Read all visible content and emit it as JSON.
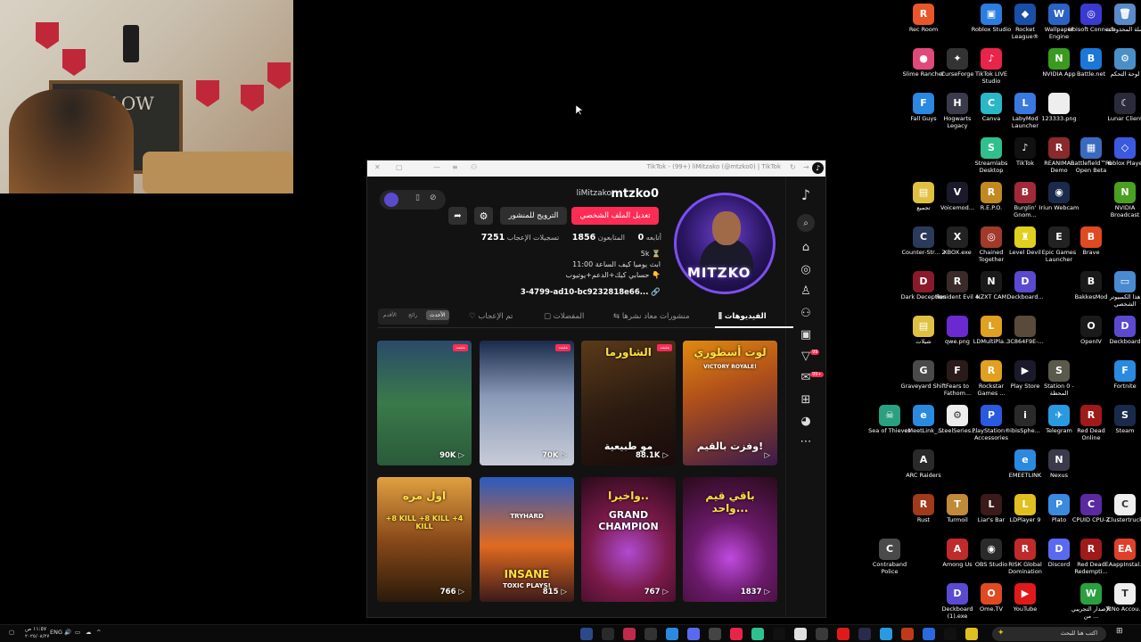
{
  "window": {
    "title": "TikTok - (99+) liMitzako (@mtzko0) | TikTok",
    "logo_icon": "tiktok-logo-icon"
  },
  "profile": {
    "username": "mtzko0",
    "nickname": "liMitzako",
    "edit_label": "تعديل الملف الشخصي",
    "promote_label": "الترويج للمنشور",
    "avatar_text": "MITZKO",
    "stats": {
      "following_label": "أتابعه",
      "following_value": "0",
      "followers_label": "المتابعون",
      "followers_value": "1856",
      "likes_label": "تسجيلات الإعجاب",
      "likes_value": "7251"
    },
    "bio_lines": [
      "5k ⏳",
      "ابث يوميا كيف الساعة 11:00",
      "حسابي كيك+الدعم+يوتيوب 👇"
    ],
    "link": "3-4799-ad10-bc9232818e66..."
  },
  "tabs": {
    "videos": "الفيديوهات",
    "reposts": "منشورات معاد نشرها",
    "favorites": "المفضلات",
    "liked": "تم الإعجاب",
    "sort_latest": "الأحدث",
    "sort_popular": "رائج",
    "sort_oldest": "الأقدم"
  },
  "videos": [
    {
      "caption": "لوت أسطوري",
      "caption2": "وفزت بالقيم!",
      "views": "",
      "pinned": false
    },
    {
      "caption": "الشاورما",
      "caption2": "مو طبيعية",
      "views": "88.1K",
      "pinned": true,
      "pin_label": "مثبت"
    },
    {
      "caption": "",
      "caption2": "",
      "views": "70K",
      "pinned": true,
      "pin_label": "مثبت"
    },
    {
      "caption": "",
      "caption2": "",
      "views": "90K",
      "pinned": true,
      "pin_label": "مثبت"
    },
    {
      "caption": "باقي قيم واحد...",
      "caption2": "",
      "views": "1837",
      "pinned": false
    },
    {
      "caption": "واخيرا..",
      "caption2": "GRAND CHAMPION",
      "views": "767",
      "pinned": false
    },
    {
      "caption": "INSANE",
      "caption2": "TOXIC PLAYS!",
      "views": "815",
      "pinned": false
    },
    {
      "caption": "اول مره",
      "caption2": "+8 KILL +8 KILL +4 KILL",
      "views": "766",
      "pinned": false
    }
  ],
  "thumb_texts": {
    "victory": "VICTORY ROYALE!",
    "tryhard": "TRYHARD"
  },
  "webcam": {
    "board_text": "FOLLOW"
  },
  "rail_badges": {
    "activity": "99",
    "inbox": "99+"
  },
  "desktop_icons": [
    {
      "label": "Rec Room",
      "color": "#e8562a",
      "glyph": "R"
    },
    {
      "label": "Roblox Studio",
      "color": "#2b7de0",
      "glyph": "▣"
    },
    {
      "label": "Rocket League®",
      "color": "#1a4fa8",
      "glyph": "◆"
    },
    {
      "label": "Wallpaper Engine",
      "color": "#2a63c4",
      "glyph": "W"
    },
    {
      "label": "Ubisoft Connect",
      "color": "#3a3ad0",
      "glyph": "◎"
    },
    {
      "label": "سلة المحذوفات",
      "color": "#5a8ac8",
      "glyph": "🗑"
    },
    {
      "label": "Slime Rancher",
      "color": "#e04a7a",
      "glyph": "●"
    },
    {
      "label": "CurseForge",
      "color": "#333333",
      "glyph": "✦"
    },
    {
      "label": "TikTok LIVE Studio",
      "color": "#e8244a",
      "glyph": "♪"
    },
    {
      "label": "NVIDIA App",
      "color": "#3a9a20",
      "glyph": "N"
    },
    {
      "label": "Battle.net",
      "color": "#1a78d8",
      "glyph": "B"
    },
    {
      "label": "لوحة التحكم",
      "color": "#4a90c8",
      "glyph": "⚙"
    },
    {
      "label": "Fall Guys",
      "color": "#2a88e0",
      "glyph": "F"
    },
    {
      "label": "Hogwarts Legacy",
      "color": "#3a3a4a",
      "glyph": "H"
    },
    {
      "label": "Canva",
      "color": "#2ab8c8",
      "glyph": "C"
    },
    {
      "label": "LabyMod Launcher",
      "color": "#3a7ae0",
      "glyph": "L"
    },
    {
      "label": "123333.png",
      "color": "#eeeeee",
      "glyph": " "
    },
    {
      "label": "Lunar Client",
      "color": "#2a2a3a",
      "glyph": "☾"
    },
    {
      "label": "Streamlabs Desktop",
      "color": "#30c090",
      "glyph": "S"
    },
    {
      "label": "TikTok",
      "color": "#111111",
      "glyph": "♪"
    },
    {
      "label": "REANIMAL Demo",
      "color": "#8a2a2a",
      "glyph": "R"
    },
    {
      "label": "Battlefield™ 6 Open Beta",
      "color": "#3a6ac0",
      "glyph": "▦"
    },
    {
      "label": "Roblox Player",
      "color": "#3a5ae0",
      "glyph": "◇"
    },
    {
      "label": "تجميع",
      "color": "#e0c040",
      "glyph": "▤"
    },
    {
      "label": "Voicemod...",
      "color": "#1a1a2a",
      "glyph": "V"
    },
    {
      "label": "R.E.P.O.",
      "color": "#c08a20",
      "glyph": "R"
    },
    {
      "label": "Burglin' Gnom...",
      "color": "#a02a3a",
      "glyph": "B"
    },
    {
      "label": "Iriun Webcam",
      "color": "#1a2a4a",
      "glyph": "◉"
    },
    {
      "label": "NVIDIA Broadcast",
      "color": "#4aa020",
      "glyph": "N"
    },
    {
      "label": "Counter-Str... 2",
      "color": "#2a3a5a",
      "glyph": "C"
    },
    {
      "label": "XBOX.exe",
      "color": "#222222",
      "glyph": "X"
    },
    {
      "label": "Chained Together",
      "color": "#a03a2a",
      "glyph": "◎"
    },
    {
      "label": "Level Devil",
      "color": "#e0d020",
      "glyph": "♜"
    },
    {
      "label": "Epic Games Launcher",
      "color": "#222222",
      "glyph": "E"
    },
    {
      "label": "Brave",
      "color": "#e04a20",
      "glyph": "B"
    },
    {
      "label": "Dark Deception",
      "color": "#8a1a2a",
      "glyph": "D"
    },
    {
      "label": "Resident Evil 4",
      "color": "#3a2a2a",
      "glyph": "R"
    },
    {
      "label": "NZXT CAM",
      "color": "#1a1a1a",
      "glyph": "N"
    },
    {
      "label": "Deckboard...",
      "color": "#5a4ad0",
      "glyph": "D"
    },
    {
      "label": "BakkesMod",
      "color": "#1a1a1a",
      "glyph": "B"
    },
    {
      "label": "هذا الكمبيوتر الشخصي",
      "color": "#4a8ad0",
      "glyph": "▭"
    },
    {
      "label": "شيلات",
      "color": "#e0c040",
      "glyph": "▤"
    },
    {
      "label": "qwe.png",
      "color": "#6a2ad0",
      "glyph": " "
    },
    {
      "label": "LDMultiPla...",
      "color": "#e0a020",
      "glyph": "L"
    },
    {
      "label": "3C864F9E-...",
      "color": "#5a4a3a",
      "glyph": " "
    },
    {
      "label": "OpenIV",
      "color": "#1a1a1a",
      "glyph": "O"
    },
    {
      "label": "Deckboard",
      "color": "#5a4ad0",
      "glyph": "D"
    },
    {
      "label": "Graveyard Shift",
      "color": "#4a4a4a",
      "glyph": "G"
    },
    {
      "label": "Fears to Fathom...",
      "color": "#2a1a1a",
      "glyph": "F"
    },
    {
      "label": "Rockstar Games ...",
      "color": "#e0a020",
      "glyph": "R"
    },
    {
      "label": "Play Store",
      "color": "#1a1a2a",
      "glyph": "▶"
    },
    {
      "label": "Station 0 - المحطة",
      "color": "#5a5a4a",
      "glyph": "S"
    },
    {
      "label": "Fortnite",
      "color": "#2a8ae0",
      "glyph": "F"
    },
    {
      "label": "Sea of Thieves",
      "color": "#2aa080",
      "glyph": "☠"
    },
    {
      "label": "eMeetLink_...",
      "color": "#2a8ae0",
      "glyph": "e"
    },
    {
      "label": "SteelSeries...",
      "color": "#eeeeee",
      "glyph": "⚙"
    },
    {
      "label": "PlayStation® Accessories",
      "color": "#2a5ae0",
      "glyph": "P"
    },
    {
      "label": "ibisSphe...",
      "color": "#2a2a2a",
      "glyph": "i"
    },
    {
      "label": "Telegram",
      "color": "#2a9ae0",
      "glyph": "✈"
    },
    {
      "label": "Red Dead Online",
      "color": "#a01a1a",
      "glyph": "R"
    },
    {
      "label": "Steam",
      "color": "#1a2a4a",
      "glyph": "S"
    },
    {
      "label": "ARC Raiders",
      "color": "#2a2a2a",
      "glyph": "A"
    },
    {
      "label": "EMEETLINK",
      "color": "#2a8ae0",
      "glyph": "e"
    },
    {
      "label": "Nexus",
      "color": "#3a3a4a",
      "glyph": "N"
    },
    {
      "label": "Rust",
      "color": "#a03a1a",
      "glyph": "R"
    },
    {
      "label": "Turmoil",
      "color": "#c08a3a",
      "glyph": "T"
    },
    {
      "label": "Liar's Bar",
      "color": "#3a1a1a",
      "glyph": "L"
    },
    {
      "label": "LDPlayer 9",
      "color": "#e0c020",
      "glyph": "L"
    },
    {
      "label": "Plato",
      "color": "#3a8ae0",
      "glyph": "P"
    },
    {
      "label": "CPUID CPU-Z",
      "color": "#5a2aa0",
      "glyph": "C"
    },
    {
      "label": "Clustertruck",
      "color": "#eeeeee",
      "glyph": "C"
    },
    {
      "label": "Contraband Police",
      "color": "#4a4a4a",
      "glyph": "C"
    },
    {
      "label": "Among Us",
      "color": "#c02a2a",
      "glyph": "A"
    },
    {
      "label": "OBS Studio",
      "color": "#2a2a2a",
      "glyph": "◉"
    },
    {
      "label": "RISK Global Domination",
      "color": "#c02a2a",
      "glyph": "R"
    },
    {
      "label": "Discord",
      "color": "#5a6af0",
      "glyph": "D"
    },
    {
      "label": "Red Dead Redempti...",
      "color": "#a01a1a",
      "glyph": "R"
    },
    {
      "label": "EAappInstal...",
      "color": "#e0402a",
      "glyph": "EA"
    },
    {
      "label": "Deckboard (1).exe",
      "color": "#5a4ad0",
      "glyph": "D"
    },
    {
      "label": "Ome.TV",
      "color": "#e04a20",
      "glyph": "O"
    },
    {
      "label": "YouTube",
      "color": "#e01a1a",
      "glyph": "▶"
    },
    {
      "label": "الإصدار التجريبي من ...",
      "color": "#2aa040",
      "glyph": "W"
    },
    {
      "label": "TcNo Accou...",
      "color": "#eeeeee",
      "glyph": "T"
    }
  ],
  "taskbar": {
    "search_placeholder": "اكتب هنا للبحث",
    "lang": "ENG",
    "time": "١١:٥٧ ص",
    "date": "٢٠٢٥/٠٨/٢٧"
  }
}
